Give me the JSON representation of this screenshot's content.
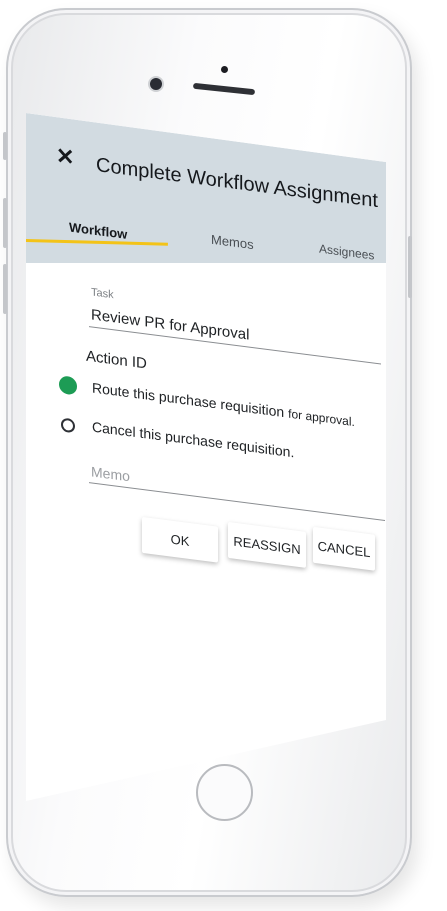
{
  "header": {
    "close_icon": "close-icon",
    "title": "Complete Workflow Assignment",
    "tabs": [
      {
        "label": "Workflow",
        "active": true
      },
      {
        "label": "Memos",
        "active": false
      },
      {
        "label": "Assignees",
        "active": false
      }
    ]
  },
  "form": {
    "task": {
      "label": "Task",
      "value": "Review PR for Approval"
    },
    "action_id": {
      "label": "Action ID",
      "options": [
        {
          "label": "Route this purchase requisition",
          "suffix": "for approval.",
          "selected": true
        },
        {
          "label": "Cancel this purchase requisition.",
          "suffix": "",
          "selected": false
        }
      ]
    },
    "memo": {
      "placeholder": "Memo",
      "value": ""
    }
  },
  "actions": {
    "ok_label": "OK",
    "reassign_label": "REASSIGN",
    "cancel_label": "CANCEL"
  },
  "colors": {
    "appbar": "#d2dbe1",
    "tab_indicator": "#f3c318",
    "radio_selected": "#1d9c55"
  }
}
